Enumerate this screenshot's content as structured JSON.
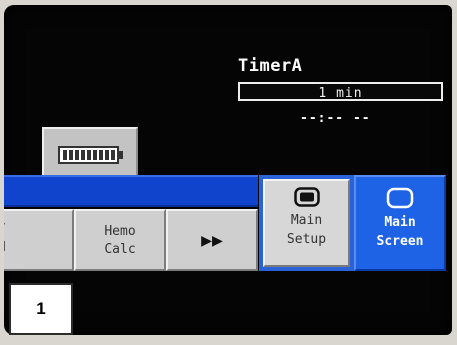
{
  "timer": {
    "title": "TimerA",
    "interval": "1 min",
    "display": "--:-- --"
  },
  "battery": {
    "icon": "battery-icon"
  },
  "keys": {
    "partial": {
      "line1": "/",
      "line2": "d"
    },
    "hemo_calc": {
      "line1": "Hemo",
      "line2": "Calc"
    },
    "more": {
      "label": "▶▶",
      "icon": "fast-forward-icon"
    },
    "main_setup": {
      "line1": "Main",
      "line2": "Setup",
      "icon": "monitor-filled-icon"
    },
    "main_screen": {
      "line1": "Main",
      "line2": "Screen",
      "icon": "monitor-outline-icon"
    }
  },
  "label_card": {
    "text": "1"
  },
  "colors": {
    "screen_background": "#050505",
    "key_gray": "#cfcfcf",
    "blue_bar": "#1144cc",
    "main_screen_blue": "#1e63e6"
  }
}
